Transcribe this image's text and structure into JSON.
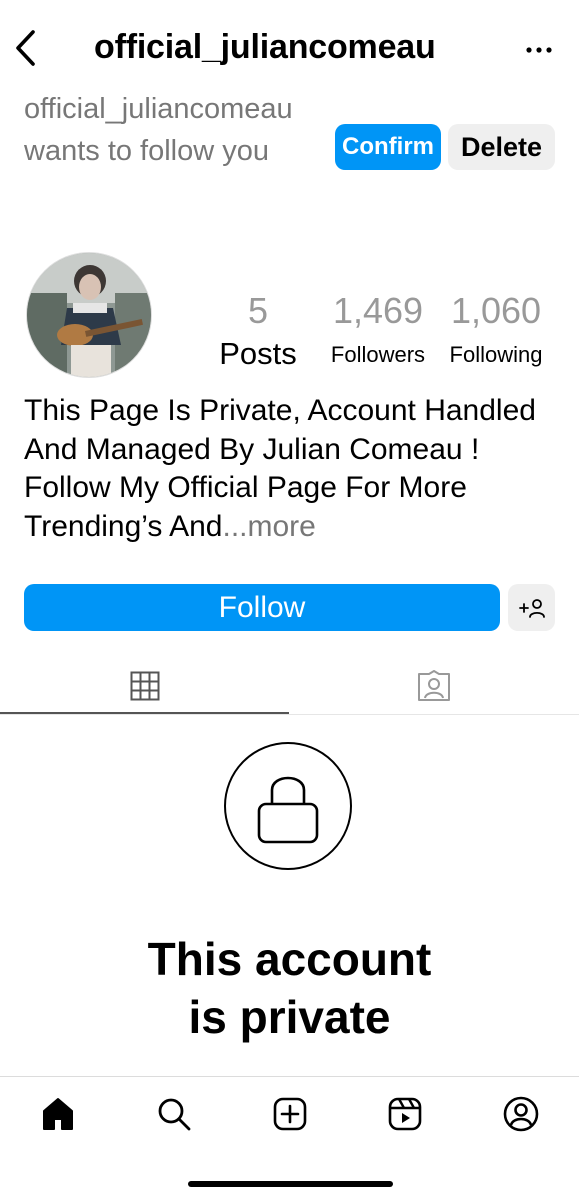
{
  "header": {
    "title": "official_juliancomeau",
    "back_icon": "chevron-left-icon",
    "more_icon": "more-horizontal-icon"
  },
  "follow_request": {
    "text": "official_juliancomeau wants to follow you",
    "confirm_label": "Confirm",
    "delete_label": "Delete"
  },
  "profile": {
    "avatar_icon": "profile-photo",
    "stats": {
      "posts": {
        "value": "5",
        "label": "Posts"
      },
      "followers": {
        "value": "1,469",
        "label": "Followers"
      },
      "following": {
        "value": "1,060",
        "label": "Following"
      }
    },
    "bio": "This Page Is Private, Account Handled And Managed By Julian Comeau ! Follow My Official Page For More Trending’s And",
    "bio_ellipsis": "...",
    "bio_more": "more"
  },
  "actions": {
    "follow_label": "Follow",
    "suggest_icon": "add-person-icon"
  },
  "tabs": [
    {
      "name": "grid",
      "icon": "grid-icon",
      "active": true
    },
    {
      "name": "tagged",
      "icon": "tagged-icon",
      "active": false
    }
  ],
  "private": {
    "icon": "lock-icon",
    "title_line1": "This account",
    "title_line2": "is private"
  },
  "bottom_nav": [
    "home-icon",
    "search-icon",
    "create-icon",
    "reels-icon",
    "profile-icon"
  ],
  "colors": {
    "accent": "#0095f6",
    "secondary_button": "#efefef",
    "muted_text": "#777777"
  }
}
